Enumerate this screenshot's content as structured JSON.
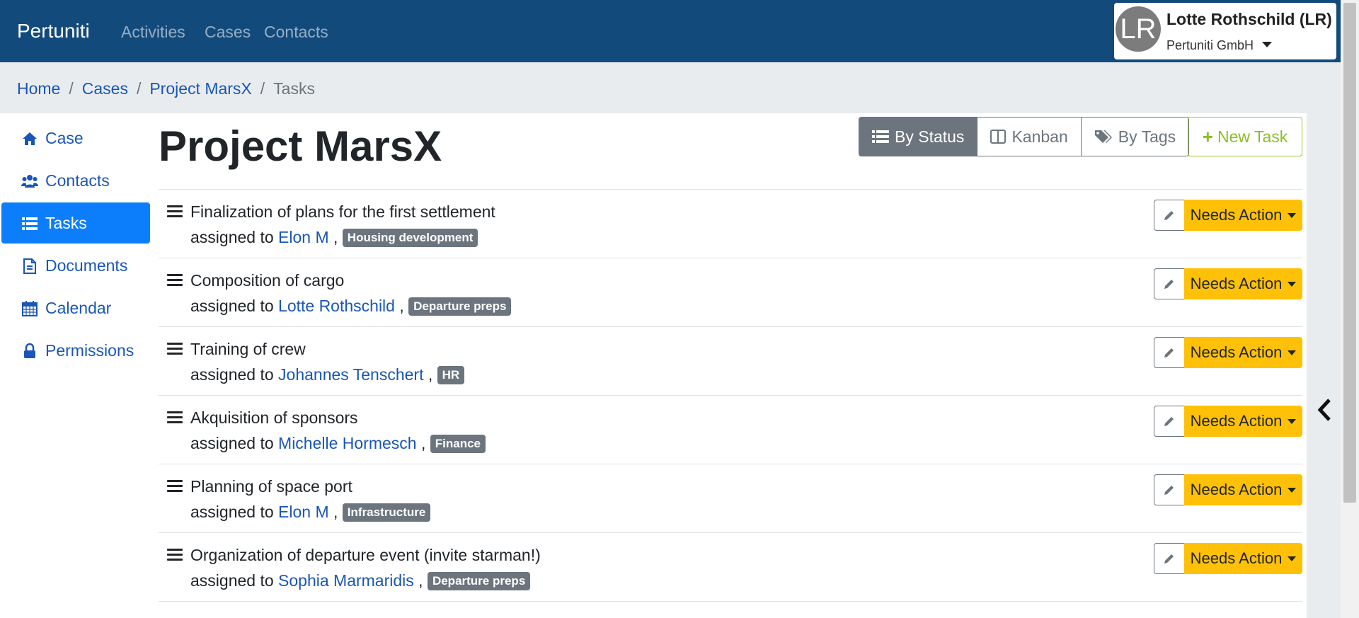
{
  "navbar": {
    "brand": "Pertuniti",
    "links": [
      "Activities",
      "Cases",
      "Contacts"
    ],
    "user": {
      "initials": "LR",
      "name": "Lotte Rothschild (LR)",
      "org": "Pertuniti GmbH"
    }
  },
  "breadcrumb": {
    "items": [
      "Home",
      "Cases",
      "Project MarsX"
    ],
    "active": "Tasks",
    "separator": "/"
  },
  "sidebar": {
    "items": [
      {
        "label": "Case",
        "icon": "home-icon"
      },
      {
        "label": "Contacts",
        "icon": "users-icon"
      },
      {
        "label": "Tasks",
        "icon": "list-icon",
        "active": true
      },
      {
        "label": "Documents",
        "icon": "document-icon"
      },
      {
        "label": "Calendar",
        "icon": "calendar-icon"
      },
      {
        "label": "Permissions",
        "icon": "lock-icon"
      }
    ]
  },
  "page": {
    "title": "Project MarsX",
    "views": [
      {
        "label": "By Status",
        "icon": "list-icon",
        "active": true
      },
      {
        "label": "Kanban",
        "icon": "columns-icon"
      },
      {
        "label": "By Tags",
        "icon": "tags-icon"
      }
    ],
    "new_task_label": "New Task"
  },
  "tasks": [
    {
      "title": "Finalization of plans for the first settlement",
      "assigned_prefix": "assigned to",
      "assignee": "Elon M",
      "tag": "Housing development",
      "status": "Needs Action"
    },
    {
      "title": "Composition of cargo",
      "assigned_prefix": "assigned to",
      "assignee": "Lotte Rothschild",
      "tag": "Departure preps",
      "status": "Needs Action"
    },
    {
      "title": "Training of crew",
      "assigned_prefix": "assigned to",
      "assignee": "Johannes Tenschert",
      "tag": "HR",
      "status": "Needs Action"
    },
    {
      "title": "Akquisition of sponsors",
      "assigned_prefix": "assigned to",
      "assignee": "Michelle Hormesch",
      "tag": "Finance",
      "status": "Needs Action"
    },
    {
      "title": "Planning of space port",
      "assigned_prefix": "assigned to",
      "assignee": "Elon M",
      "tag": "Infrastructure",
      "status": "Needs Action"
    },
    {
      "title": "Organization of departure event (invite starman!)",
      "assigned_prefix": "assigned to",
      "assignee": "Sophia Marmaridis",
      "tag": "Departure preps",
      "status": "Needs Action"
    }
  ],
  "colors": {
    "navbar": "#134a7c",
    "link": "#1a56b7",
    "active": "#0d7efb",
    "warning": "#ffc107",
    "success_outline": "#9ac731",
    "secondary": "#6c757d"
  }
}
